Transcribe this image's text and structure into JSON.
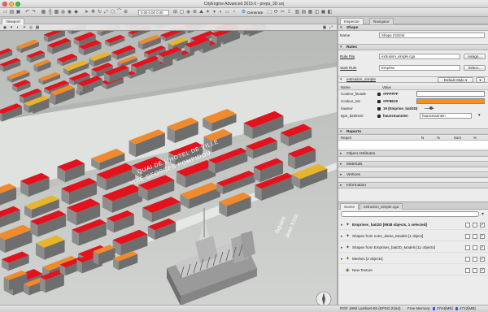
{
  "window": {
    "title": "CityEngine Advanced 2015.0 - prepa_3D.cej"
  },
  "toolbar": {
    "coord_value": "0.00 0.00 0.00",
    "generate_label": "Generate"
  },
  "viewport": {
    "tab_label": "Viewport",
    "street_label_1": "QUAI DE L'HOTEL DE VILLE",
    "street_label_2": "VOIE GEORGES POMPIDOU",
    "park_label_1": "Square",
    "park_label_2": "Jean XXIII"
  },
  "inspector": {
    "tab_inspector": "Inspector",
    "tab_navigator": "Navigator",
    "shape_header": "Shape",
    "name_label": "Name",
    "name_value": "Shape 243244",
    "rules_header": "Rules",
    "rule_file_label": "Rule File",
    "rule_file_value": "extrusion_simple.cga",
    "assign_button": "Assign...",
    "start_rule_label": "Start Rule",
    "start_rule_value": "Emprise",
    "select_button": "Select...",
    "rule_section_label": "extrusion_simple",
    "default_style": "Default Style",
    "attr_col_name": "Name",
    "attr_col_value": "Value",
    "attributes": [
      {
        "name": "Couleur_facade",
        "value": "#FFFFFF",
        "swatch": "#ffffff"
      },
      {
        "name": "Couleur_toit",
        "value": "#FF8E20",
        "swatch": "#ff8e20"
      },
      {
        "name": "hauteur",
        "value": "19 (Emprise_bati2D)"
      },
      {
        "name": "type_batiment",
        "value": "haussmannien",
        "select": "haussmannien"
      }
    ],
    "reports_header": "Reports",
    "report_cols": [
      "Report",
      "N",
      "%",
      "Sum",
      "%"
    ],
    "sections": [
      "Object Attributes",
      "Materials",
      "Vertices",
      "Information"
    ]
  },
  "scene": {
    "tab_scene": "Scene",
    "tab_other": "extrusion_simple.cga",
    "items": [
      {
        "label": "Emprises_bati2D [9938 objects, 1 selected]",
        "bold": true
      },
      {
        "label": "Shapes from notre_dame_Models [1 object]",
        "bold": false
      },
      {
        "label": "Shapes from Emprises_bati2D_Models [11 objects]",
        "bold": false
      },
      {
        "label": "Meshes [2 objects]",
        "bold": false
      },
      {
        "label": "New Texture",
        "bold": false
      }
    ]
  },
  "status": {
    "crs": "RGF 1993 Lambert-93 (EPSG:2154)",
    "free_memory_label": "Free Memory:",
    "mem1": "3744[MB]",
    "mem2": "4712[MB]"
  },
  "colors": {
    "roof_red": "#e3121c",
    "roof_orange": "#f08a2c",
    "roof_yellow": "#e6b52a",
    "wall": "#8a8a8a",
    "ground": "#c9cbc9",
    "water": "#d8dcd8"
  }
}
